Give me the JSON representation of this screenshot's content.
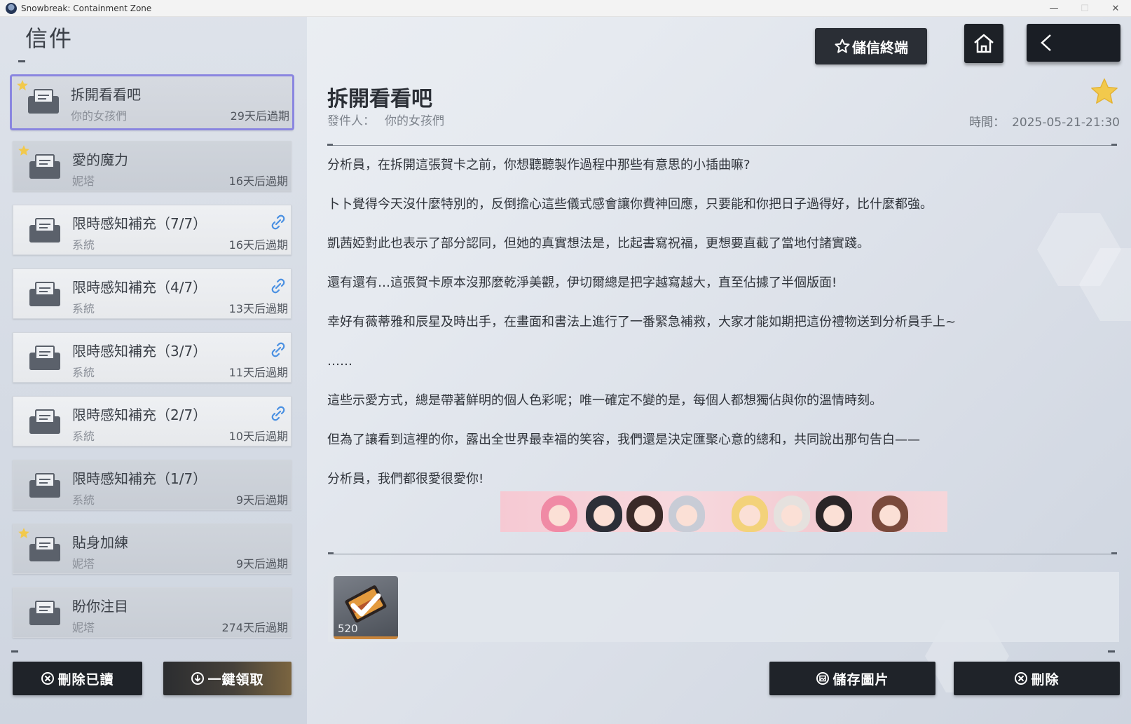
{
  "window": {
    "title": "Snowbreak: Containment Zone",
    "controls": [
      "—",
      "☐",
      "✕"
    ]
  },
  "page": {
    "title": "信件"
  },
  "header": {
    "save_terminal_label": "儲信終端",
    "home_icon": "home-icon",
    "back_icon": "chevron-left-icon"
  },
  "mail_list": [
    {
      "subject": "拆開看看吧",
      "sender": "你的女孩們",
      "expire": "29天后過期",
      "starred": true,
      "attachment": false,
      "selected": true,
      "read": true
    },
    {
      "subject": "愛的魔力",
      "sender": "妮塔",
      "expire": "16天后過期",
      "starred": true,
      "attachment": false,
      "selected": false,
      "read": true
    },
    {
      "subject": "限時感知補充（7/7）",
      "sender": "系統",
      "expire": "16天后過期",
      "starred": false,
      "attachment": true,
      "selected": false,
      "read": false
    },
    {
      "subject": "限時感知補充（4/7）",
      "sender": "系統",
      "expire": "13天后過期",
      "starred": false,
      "attachment": true,
      "selected": false,
      "read": false
    },
    {
      "subject": "限時感知補充（3/7）",
      "sender": "系統",
      "expire": "11天后過期",
      "starred": false,
      "attachment": true,
      "selected": false,
      "read": false
    },
    {
      "subject": "限時感知補充（2/7）",
      "sender": "系統",
      "expire": "10天后過期",
      "starred": false,
      "attachment": true,
      "selected": false,
      "read": false
    },
    {
      "subject": "限時感知補充（1/7）",
      "sender": "系統",
      "expire": "9天后過期",
      "starred": false,
      "attachment": false,
      "selected": false,
      "read": true
    },
    {
      "subject": "貼身加練",
      "sender": "妮塔",
      "expire": "9天后過期",
      "starred": true,
      "attachment": false,
      "selected": false,
      "read": true
    },
    {
      "subject": "盼你注目",
      "sender": "妮塔",
      "expire": "274天后過期",
      "starred": false,
      "attachment": false,
      "selected": false,
      "read": true
    }
  ],
  "list_actions": {
    "delete_read_label": "刪除已讀",
    "claim_all_label": "一鍵領取"
  },
  "detail": {
    "subject": "拆開看看吧",
    "sender_label": "發件人：",
    "sender": "你的女孩們",
    "time_label": "時間：",
    "time": "2025-05-21-21:30",
    "body": [
      "分析員，在拆開這張賀卡之前，你想聽聽製作過程中那些有意思的小插曲嘛?",
      "卜卜覺得今天沒什麼特別的，反倒擔心這些儀式感會讓你費神回應，只要能和你把日子過得好，比什麼都強。",
      "凱茜婭對此也表示了部分認同，但她的真實想法是，比起書寫祝福，更想要直截了當地付諸實踐。",
      "還有還有…這張賀卡原本沒那麼乾淨美觀，伊切爾總是把字越寫越大，直至佔據了半個版面!",
      "幸好有薇蒂雅和辰星及時出手，在畫面和書法上進行了一番緊急補救，大家才能如期把這份禮物送到分析員手上~",
      "……",
      "這些示愛方式，總是帶著鮮明的個人色彩呢；唯一確定不變的是，每個人都想獨佔與你的溫情時刻。",
      "但為了讓看到這裡的你，露出全世界最幸福的笑容，我們還是決定匯聚心意的總和，共同說出那句告白——",
      "分析員，我們都很愛很愛你!"
    ],
    "attachment": {
      "quantity": "520",
      "icon": "gift-card-icon",
      "claimed": true
    }
  },
  "detail_actions": {
    "save_image_label": "儲存圖片",
    "delete_label": "刪除"
  },
  "colors": {
    "accent_selected": "#8a86e0",
    "star": "#f2c94c",
    "attachment_link": "#4a90e2",
    "button_dark": "#1f2329"
  }
}
